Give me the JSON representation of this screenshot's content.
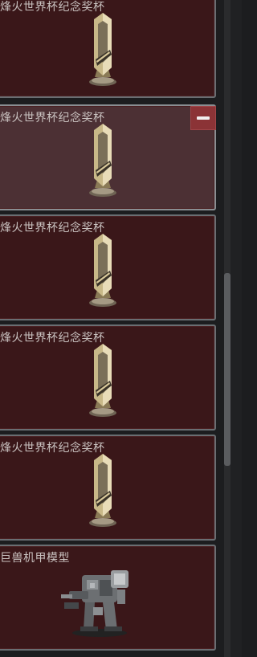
{
  "items": [
    {
      "name": "烽火世界杯纪念奖杯",
      "icon": "trophy-icon"
    },
    {
      "name": "烽火世界杯纪念奖杯",
      "icon": "trophy-icon",
      "selected": true
    },
    {
      "name": "烽火世界杯纪念奖杯",
      "icon": "trophy-icon"
    },
    {
      "name": "烽火世界杯纪念奖杯",
      "icon": "trophy-icon"
    },
    {
      "name": "烽火世界杯纪念奖杯",
      "icon": "trophy-icon"
    },
    {
      "name": "巨兽机甲模型",
      "icon": "mech-model-icon"
    }
  ],
  "remove_button": {
    "icon": "minus-icon"
  },
  "colors": {
    "card_bg": "#3a1719",
    "selected_bg": "#4c3034",
    "remove_bg": "#8b3336"
  }
}
